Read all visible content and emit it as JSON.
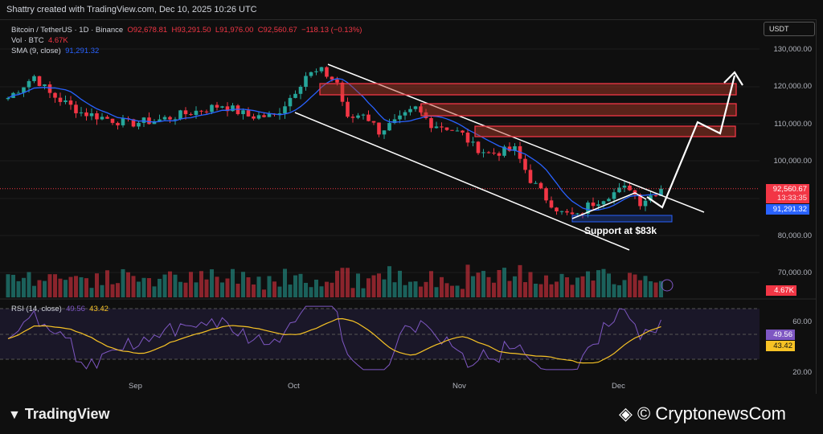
{
  "header": "Shattry created with TradingView.com, Dec 10, 2025 10:26 UTC",
  "legend": {
    "symbol": "Bitcoin / TetherUS · 1D · Binance",
    "open": "O92,678.81",
    "high": "H93,291.50",
    "low": "L91,976.00",
    "close": "C92,560.67",
    "change": "−118.13 (−0.13%)",
    "vol_label": "Vol · BTC",
    "vol_value": "4.67K",
    "sma_label": "SMA (9, close)",
    "sma_value": "91,291.32"
  },
  "currency": "USDT",
  "price_axis": [
    "130,000.00",
    "120,000.00",
    "110,000.00",
    "100,000.00",
    "80,000.00",
    "70,000.00"
  ],
  "tags": {
    "price": "92,560.67",
    "countdown": "13:33:35",
    "sma": "91,291.32",
    "volume": "4.67K",
    "rsi": "49.56",
    "rsi_ma": "43.42"
  },
  "rsi": {
    "label": "RSI (14, close)",
    "value": "49.56",
    "ma": "43.42",
    "axis": [
      "60.00",
      "20.00"
    ]
  },
  "time_axis": [
    "Sep",
    "Oct",
    "Nov",
    "Dec"
  ],
  "annotation": "Support at $83k",
  "brand": "TradingView",
  "watermark": "CryptonewsCom",
  "colors": {
    "up": "#26a69a",
    "down": "#f23645",
    "sma": "#2962ff",
    "rsi": "#7e57c2",
    "rsi_ma": "#f7c325"
  },
  "chart_data": {
    "type": "candlestick",
    "keypoints": [
      [
        0,
        116900
      ],
      [
        5,
        122700
      ],
      [
        8,
        118000
      ],
      [
        14,
        113000
      ],
      [
        23,
        110000
      ],
      [
        29,
        111000
      ],
      [
        35,
        113000
      ],
      [
        41,
        115000
      ],
      [
        46,
        112000
      ],
      [
        51,
        112000
      ],
      [
        54,
        117000
      ],
      [
        57,
        123000
      ],
      [
        60,
        124000
      ],
      [
        63,
        121000
      ],
      [
        65,
        111000
      ],
      [
        68,
        113000
      ],
      [
        71,
        108000
      ],
      [
        75,
        111000
      ],
      [
        78,
        114000
      ],
      [
        81,
        110000
      ],
      [
        84,
        109000
      ],
      [
        87,
        107000
      ],
      [
        89,
        104000
      ],
      [
        92,
        102000
      ],
      [
        97,
        103000
      ],
      [
        100,
        95000
      ],
      [
        103,
        90000
      ],
      [
        106,
        86000
      ],
      [
        109,
        85000
      ],
      [
        111,
        88000
      ],
      [
        115,
        91000
      ],
      [
        119,
        93000
      ],
      [
        121,
        89000
      ],
      [
        125,
        92560
      ]
    ]
  }
}
